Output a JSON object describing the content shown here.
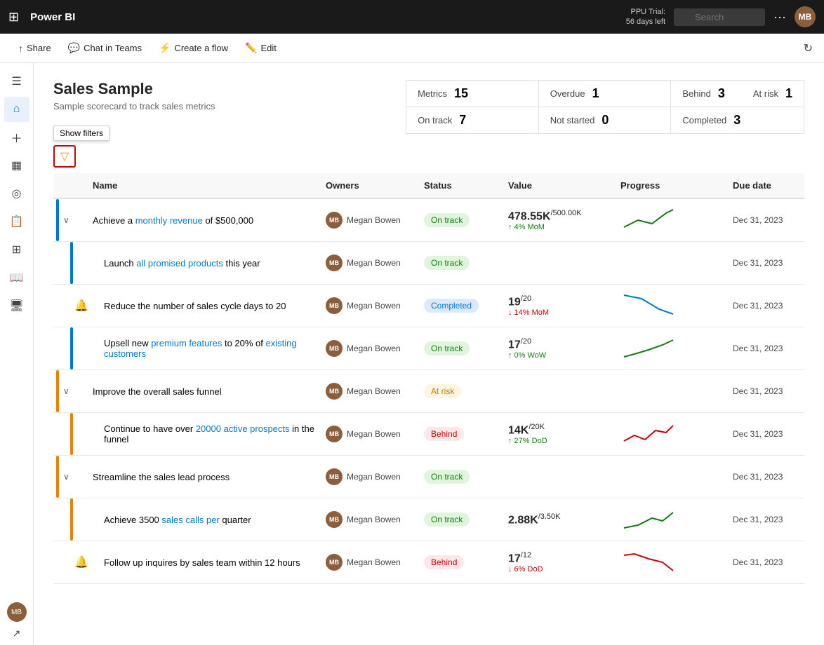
{
  "topbar": {
    "app_name": "Power BI",
    "trial_label": "PPU Trial:",
    "trial_days": "56 days left",
    "search_placeholder": "Search",
    "more_icon": "more-icon",
    "avatar_initials": "MB"
  },
  "toolbar": {
    "share_label": "Share",
    "chat_label": "Chat in Teams",
    "flow_label": "Create a flow",
    "edit_label": "Edit"
  },
  "scorecard": {
    "title": "Sales Sample",
    "subtitle": "Sample scorecard to track sales metrics",
    "metrics": [
      {
        "label": "Metrics",
        "value": "15"
      },
      {
        "label": "Overdue",
        "value": "1"
      },
      {
        "label": "Behind",
        "value": "3"
      },
      {
        "label": "On track",
        "value": "7"
      },
      {
        "label": "Not started",
        "value": "0"
      },
      {
        "label": "Completed",
        "value": "3"
      },
      {
        "label": "At risk",
        "value": "1"
      }
    ]
  },
  "table": {
    "filter_tooltip": "Show filters",
    "columns": [
      "",
      "Name",
      "Owners",
      "Status",
      "Value",
      "Progress",
      "Due date"
    ],
    "rows": [
      {
        "id": "row-1",
        "indent": false,
        "expandable": true,
        "bar_color": "blue",
        "name": "Achieve a monthly revenue of $500,000",
        "name_highlights": [
          "monthly revenue"
        ],
        "owner": "Megan Bowen",
        "status": "On track",
        "status_class": "on-track",
        "value_main": "478.55K",
        "value_denom": "/500.00K",
        "value_change": "↑ 4% MoM",
        "value_change_dir": "up",
        "chart_type": "up-green",
        "due_date": "Dec 31, 2023",
        "has_notif": false
      },
      {
        "id": "row-2",
        "indent": true,
        "expandable": false,
        "bar_color": "blue",
        "name": "Launch all promised products this year",
        "name_highlights": [
          "all",
          "promised products"
        ],
        "owner": "Megan Bowen",
        "status": "On track",
        "status_class": "on-track",
        "value_main": "",
        "value_denom": "",
        "value_change": "",
        "chart_type": "none",
        "due_date": "Dec 31, 2023",
        "has_notif": false
      },
      {
        "id": "row-3",
        "indent": true,
        "expandable": false,
        "bar_color": "blue",
        "name": "Reduce the number of sales cycle days to 20",
        "name_highlights": [],
        "owner": "Megan Bowen",
        "status": "Completed",
        "status_class": "completed",
        "value_main": "19",
        "value_denom": "/20",
        "value_change": "↓ 14% MoM",
        "value_change_dir": "down",
        "chart_type": "down-blue",
        "due_date": "Dec 31, 2023",
        "has_notif": true
      },
      {
        "id": "row-4",
        "indent": true,
        "expandable": false,
        "bar_color": "blue",
        "name": "Upsell new premium features to 20% of existing customers",
        "name_highlights": [
          "premium features"
        ],
        "owner": "Megan Bowen",
        "status": "On track",
        "status_class": "on-track",
        "value_main": "17",
        "value_denom": "/20",
        "value_change": "↑ 0% WoW",
        "value_change_dir": "up",
        "chart_type": "up-green",
        "due_date": "Dec 31, 2023",
        "has_notif": false
      },
      {
        "id": "row-5",
        "indent": false,
        "expandable": true,
        "bar_color": "orange",
        "name": "Improve the overall sales funnel",
        "name_highlights": [],
        "owner": "Megan Bowen",
        "status": "At risk",
        "status_class": "at-risk",
        "value_main": "",
        "value_denom": "",
        "value_change": "",
        "chart_type": "none",
        "due_date": "Dec 31, 2023",
        "has_notif": false
      },
      {
        "id": "row-6",
        "indent": true,
        "expandable": false,
        "bar_color": "orange",
        "name": "Continue to have over 20000 active prospects in the funnel",
        "name_highlights": [
          "20000",
          "active prospects"
        ],
        "owner": "Megan Bowen",
        "status": "Behind",
        "status_class": "behind",
        "value_main": "14K",
        "value_denom": "/20K",
        "value_change": "↑ 27% DoD",
        "value_change_dir": "up",
        "chart_type": "up-red",
        "due_date": "Dec 31, 2023",
        "has_notif": false
      },
      {
        "id": "row-7",
        "indent": false,
        "expandable": true,
        "bar_color": "orange",
        "name": "Streamline the sales lead process",
        "name_highlights": [],
        "owner": "Megan Bowen",
        "status": "On track",
        "status_class": "on-track",
        "value_main": "",
        "value_denom": "",
        "value_change": "",
        "chart_type": "none",
        "due_date": "Dec 31, 2023",
        "has_notif": false
      },
      {
        "id": "row-8",
        "indent": true,
        "expandable": false,
        "bar_color": "orange",
        "name": "Achieve 3500 sales calls per quarter",
        "name_highlights": [
          "sales calls per"
        ],
        "owner": "Megan Bowen",
        "status": "On track",
        "status_class": "on-track",
        "value_main": "2.88K",
        "value_denom": "/3.50K",
        "value_change": "",
        "chart_type": "up-green-2",
        "due_date": "Dec 31, 2023",
        "has_notif": false
      },
      {
        "id": "row-9",
        "indent": true,
        "expandable": false,
        "bar_color": "orange",
        "name": "Follow up inquires by sales team within 12 hours",
        "name_highlights": [],
        "owner": "Megan Bowen",
        "status": "Behind",
        "status_class": "behind",
        "value_main": "17",
        "value_denom": "/12",
        "value_change": "↓ 6% DoD",
        "value_change_dir": "down",
        "chart_type": "down-red",
        "due_date": "Dec 31, 2023",
        "has_notif": true
      }
    ]
  },
  "nav": {
    "icons": [
      "grid",
      "home",
      "plus",
      "layers",
      "circle",
      "bookmark",
      "grid2",
      "book",
      "monitor",
      "arrow-up-right"
    ]
  }
}
